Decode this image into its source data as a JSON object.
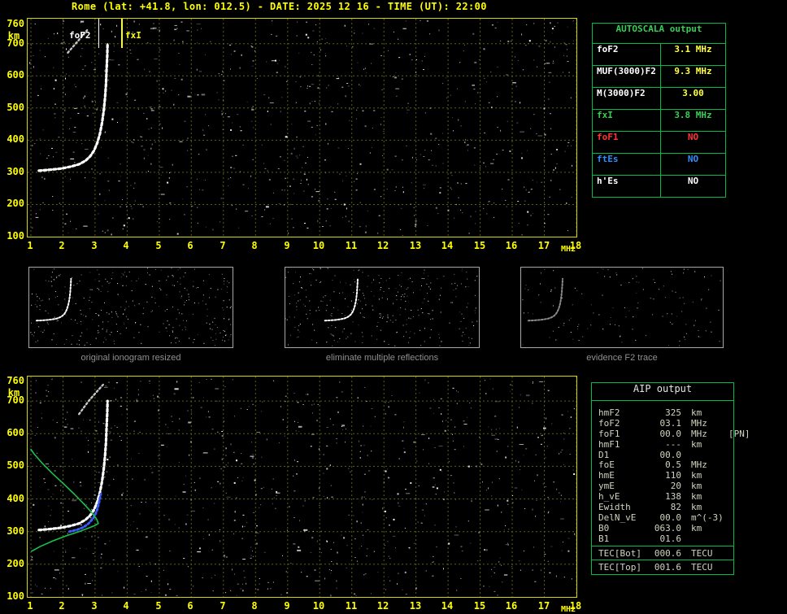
{
  "title": "Rome (lat: +41.8, lon: 012.5) - DATE: 2025 12 16 - TIME (UT): 22:00",
  "colors": {
    "background": "#000000",
    "axis_yellow": "#ffff00",
    "plot_border_yellow": "#d6d600",
    "table_green": "#00bb44",
    "grid_olive": "#5e5e14",
    "trace_white": "#ffffff",
    "profile_green": "#19c24a",
    "restored_blue": "#3a5cff",
    "caption_gray": "#909090",
    "aip_text": "#d2d2bf"
  },
  "axes": {
    "x_ticks": [
      "1",
      "2",
      "3",
      "4",
      "5",
      "6",
      "7",
      "8",
      "9",
      "10",
      "11",
      "12",
      "13",
      "14",
      "15",
      "16",
      "17",
      "18"
    ],
    "x_unit": "MHz",
    "y_ticks": [
      "760",
      "700",
      "600",
      "500",
      "400",
      "300",
      "200",
      "100"
    ],
    "y_unit": "km",
    "x_range_mhz": [
      1,
      18
    ],
    "y_range_km": [
      100,
      760
    ]
  },
  "top_plot": {
    "foF2_label": "foF2",
    "fxI_label": "fxI",
    "foF2_mhz": 3.1,
    "fxI_mhz": 3.8,
    "trace_f2": [
      [
        1.25,
        305
      ],
      [
        1.6,
        308
      ],
      [
        1.95,
        312
      ],
      [
        2.25,
        318
      ],
      [
        2.5,
        325
      ],
      [
        2.7,
        336
      ],
      [
        2.85,
        350
      ],
      [
        2.97,
        368
      ],
      [
        3.07,
        392
      ],
      [
        3.15,
        420
      ],
      [
        3.22,
        455
      ],
      [
        3.27,
        492
      ],
      [
        3.31,
        532
      ],
      [
        3.34,
        575
      ],
      [
        3.36,
        620
      ],
      [
        3.38,
        662
      ],
      [
        3.39,
        700
      ]
    ],
    "trace_second_hop": [
      [
        2.15,
        672
      ],
      [
        2.35,
        695
      ],
      [
        2.55,
        718
      ],
      [
        2.75,
        742
      ]
    ]
  },
  "bottom_plot": {
    "trace_f2": [
      [
        1.25,
        305
      ],
      [
        1.6,
        308
      ],
      [
        1.95,
        312
      ],
      [
        2.25,
        318
      ],
      [
        2.5,
        325
      ],
      [
        2.7,
        336
      ],
      [
        2.85,
        350
      ],
      [
        2.97,
        368
      ],
      [
        3.07,
        392
      ],
      [
        3.15,
        420
      ],
      [
        3.22,
        455
      ],
      [
        3.27,
        492
      ],
      [
        3.31,
        532
      ],
      [
        3.34,
        575
      ],
      [
        3.36,
        620
      ],
      [
        3.38,
        662
      ],
      [
        3.39,
        700
      ]
    ],
    "trace_second_hop": [
      [
        2.5,
        660
      ],
      [
        2.8,
        700
      ],
      [
        3.05,
        728
      ],
      [
        3.25,
        750
      ]
    ],
    "restored_trace_blue": [
      [
        2.2,
        300
      ],
      [
        2.45,
        306
      ],
      [
        2.65,
        314
      ],
      [
        2.8,
        325
      ],
      [
        2.95,
        342
      ],
      [
        3.05,
        362
      ],
      [
        3.12,
        388
      ],
      [
        3.18,
        415
      ]
    ],
    "density_profile_green": [
      [
        1.02,
        240
      ],
      [
        1.3,
        255
      ],
      [
        1.7,
        272
      ],
      [
        2.1,
        287
      ],
      [
        2.5,
        300
      ],
      [
        2.8,
        311
      ],
      [
        3.0,
        319
      ],
      [
        3.1,
        325
      ],
      [
        3.05,
        338
      ],
      [
        2.9,
        358
      ],
      [
        2.65,
        385
      ],
      [
        2.35,
        415
      ],
      [
        2.0,
        448
      ],
      [
        1.65,
        480
      ],
      [
        1.35,
        510
      ],
      [
        1.1,
        538
      ],
      [
        1.0,
        552
      ]
    ]
  },
  "thumbnails": [
    {
      "caption": "original ionogram resized"
    },
    {
      "caption": "eliminate multiple reflections"
    },
    {
      "caption": "evidence F2 trace"
    }
  ],
  "autoscala_table": {
    "header": "AUTOSCALA output",
    "rows": [
      {
        "label": "foF2",
        "value": "3.1 MHz",
        "label_color": "#ffffff",
        "value_color": "#ffff44"
      },
      {
        "label": "MUF(3000)F2",
        "value": "9.3 MHz",
        "label_color": "#ffffff",
        "value_color": "#ffff44"
      },
      {
        "label": "M(3000)F2",
        "value": "3.00",
        "label_color": "#ffffff",
        "value_color": "#ffff44"
      },
      {
        "label": "fxI",
        "value": "3.8 MHz",
        "label_color": "#35d055",
        "value_color": "#35d055"
      },
      {
        "label": "foF1",
        "value": "NO",
        "label_color": "#ff3434",
        "value_color": "#ff3434"
      },
      {
        "label": "ftEs",
        "value": "NO",
        "label_color": "#2f8fff",
        "value_color": "#2f8fff"
      },
      {
        "label": "h'Es",
        "value": "NO",
        "label_color": "#ffffff",
        "value_color": "#ffffff"
      }
    ]
  },
  "aip_table": {
    "header": "AIP output",
    "rows": [
      {
        "name": "hmF2",
        "value": "325",
        "unit": "km",
        "extra": ""
      },
      {
        "name": "foF2",
        "value": "03.1",
        "unit": "MHz",
        "extra": ""
      },
      {
        "name": "foF1",
        "value": "00.0",
        "unit": "MHz",
        "extra": "[PN]"
      },
      {
        "name": "hmF1",
        "value": "---",
        "unit": "km",
        "extra": ""
      },
      {
        "name": "D1",
        "value": "00.0",
        "unit": "",
        "extra": ""
      },
      {
        "name": "foE",
        "value": "0.5",
        "unit": "MHz",
        "extra": ""
      },
      {
        "name": "hmE",
        "value": "110",
        "unit": "km",
        "extra": ""
      },
      {
        "name": "ymE",
        "value": "20",
        "unit": "km",
        "extra": ""
      },
      {
        "name": "h_vE",
        "value": "138",
        "unit": "km",
        "extra": ""
      },
      {
        "name": "Ewidth",
        "value": "82",
        "unit": "km",
        "extra": ""
      },
      {
        "name": "DelN_vE",
        "value": "00.0",
        "unit": "m^(-3)",
        "extra": ""
      },
      {
        "name": "B0",
        "value": "063.0",
        "unit": "km",
        "extra": ""
      },
      {
        "name": "B1",
        "value": "01.6",
        "unit": "",
        "extra": ""
      }
    ],
    "tec_rows": [
      {
        "name": "TEC[Bot]",
        "value": "000.6",
        "unit": "TECU"
      },
      {
        "name": "TEC[Top]",
        "value": "001.6",
        "unit": "TECU"
      }
    ]
  }
}
